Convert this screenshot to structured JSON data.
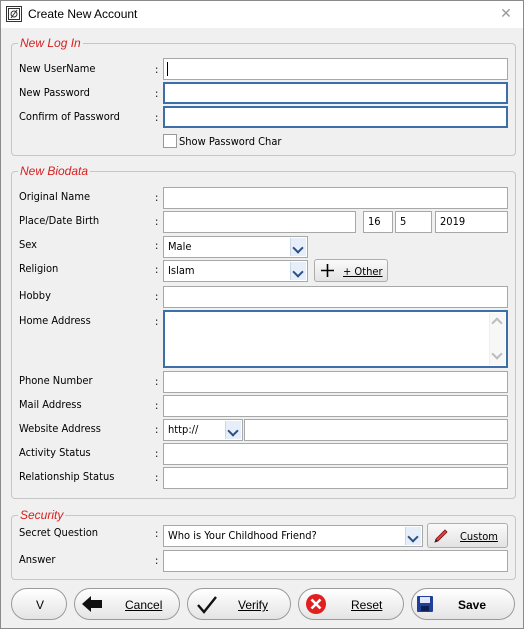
{
  "window": {
    "title": "Create New Account",
    "close_glyph": "✕"
  },
  "login": {
    "legend": "New Log In",
    "username_label": "New UserName",
    "password_label": "New Password",
    "confirm_label": "Confirm of Password",
    "show_password_label": "Show Password Char",
    "show_password_checked": false
  },
  "biodata": {
    "legend": "New Biodata",
    "original_name_label": "Original Name",
    "birth_label": "Place/Date Birth",
    "birth_day": "16",
    "birth_month": "5",
    "birth_year": "2019",
    "sex_label": "Sex",
    "sex_value": "Male",
    "religion_label": "Religion",
    "religion_value": "Islam",
    "other_button": "+ Other",
    "hobby_label": "Hobby",
    "address_label": "Home Address",
    "phone_label": "Phone Number",
    "mail_label": "Mail Address",
    "website_label": "Website Address",
    "website_protocol": "http://",
    "activity_label": "Activity Status",
    "relationship_label": "Relationship Status"
  },
  "security": {
    "legend": "Security",
    "question_label": "Secret Question",
    "question_value": "Who is Your Childhood Friend?",
    "custom_button": "Custom",
    "answer_label": "Answer"
  },
  "buttons": {
    "v": "V",
    "cancel": "Cancel",
    "verify": "Verify",
    "reset": "Reset",
    "save": "Save"
  },
  "colon": ":",
  "colors": {
    "legend": "#d82020",
    "focus_border": "#3c6ea8",
    "reset_icon": "#e02020"
  }
}
